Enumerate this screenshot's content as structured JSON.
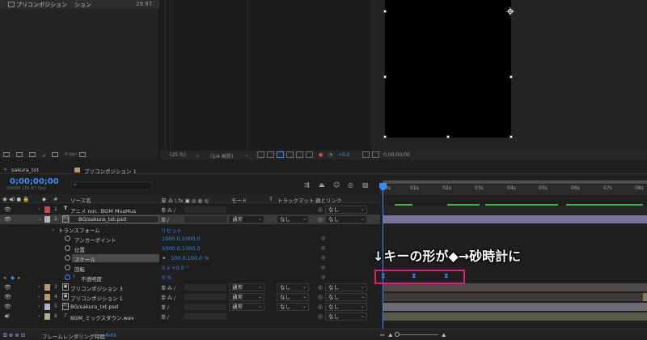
{
  "project": {
    "item_name": "プリコンポジション",
    "item_suffix": "ション",
    "item_fps": "29.97",
    "bpc": "8 bpc"
  },
  "viewer_toolbar": {
    "zoom": "(25 %)",
    "resolution": "(1/4 画質)",
    "exposure": "+0.0",
    "timecode": "0;00;00;00"
  },
  "timeline": {
    "tabs": [
      "sakura_txt",
      "プリコンポジション 1"
    ],
    "timecode": "0;00;00;00",
    "fps_sub": "00000 (29.97 fps)",
    "headers": {
      "num": "#",
      "source_name": "ソース名",
      "switches": "単 ⁂ \\ fx ▣ ◎ ◍ ◎",
      "mode": "モード",
      "t": "T",
      "track_matte": "トラックマット",
      "parent": "親とリンク"
    },
    "ruler": [
      "0s",
      "01s",
      "02s",
      "03s",
      "04s",
      "05s",
      "06s",
      "07s",
      "08s"
    ],
    "layers": [
      {
        "num": "1",
        "type": "T",
        "name": "アニメ nor.. BGM MusMus",
        "color": "#c84b4b",
        "mode": "",
        "track": "",
        "parent": "なし"
      },
      {
        "num": "2",
        "type": "Ps",
        "name": "BG/sakura_txt.psd",
        "color": "#b6b0c8",
        "mode": "通常",
        "track": "なし",
        "parent": "なし"
      },
      {
        "num": "3",
        "type": "▣",
        "name": "プリコンポジション 3",
        "color": "#b99a6a",
        "mode": "通常",
        "track": "なし",
        "parent": "なし"
      },
      {
        "num": "4",
        "type": "▣",
        "name": "プリコンポジション 1",
        "color": "#b99a6a",
        "mode": "通常",
        "track": "なし",
        "parent": "なし"
      },
      {
        "num": "5",
        "type": "Ps",
        "name": "BG/sakura_txt.psd",
        "color": "#b6b0c8",
        "mode": "通常",
        "track": "なし",
        "parent": "なし"
      },
      {
        "num": "6",
        "type": "♪",
        "name": "BGM_ミックスダウン.wav",
        "color": "#a8b38a",
        "mode": "",
        "track": "",
        "parent": "なし"
      }
    ],
    "transform": {
      "label": "トランスフォーム",
      "reset": "リセット",
      "anchor_label": "アンカーポイント",
      "anchor_value": "1000.0,1000.0",
      "position_label": "位置",
      "position_value": "1000.0,1000.0",
      "scale_label": "スケール",
      "scale_value": "100.0,100.0 %",
      "rotation_label": "回転",
      "rotation_value": "0 x +0.0 °",
      "opacity_label": "不透明度",
      "opacity_value": "0 %"
    }
  },
  "annotation": "↓キーの形が◆→砂時計に",
  "bottom": {
    "render_label": "フレームレンダリング時間",
    "render_time": "4ms"
  },
  "colors": {
    "accent": "#3b8ef1",
    "highlight": "#e7187c",
    "green_marker": "#3fb34a"
  }
}
